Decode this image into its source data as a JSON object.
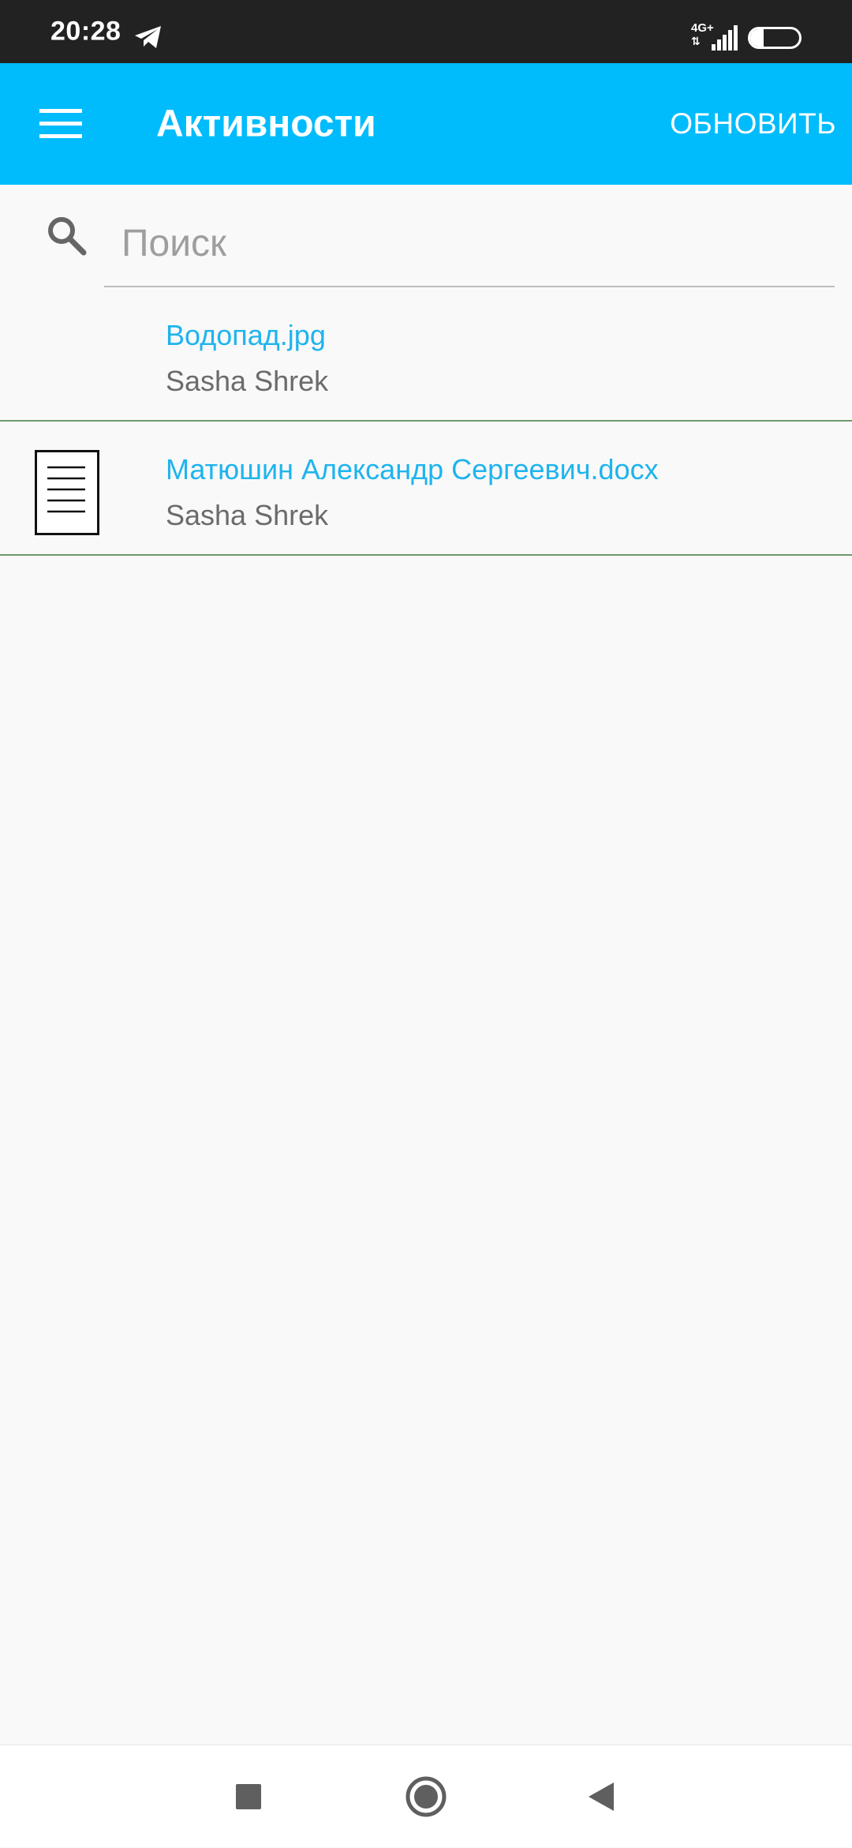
{
  "status_bar": {
    "time": "20:28",
    "network": "4G+",
    "network_arrows": "⇅",
    "battery": "28",
    "battery_level": 0.28
  },
  "app_bar": {
    "title": "Активности",
    "refresh_label": "ОБНОВИТЬ",
    "color": "#00bcfc"
  },
  "search": {
    "placeholder": "Поиск",
    "value": ""
  },
  "files": [
    {
      "name": "Водопад.jpg",
      "owner": "Sasha Shrek",
      "icon": "none"
    },
    {
      "name": "Матюшин Александр Сергеевич.docx",
      "owner": "Sasha Shrek",
      "icon": "document-icon"
    }
  ],
  "colors": {
    "accent": "#00bcfc",
    "file_name": "#1eb4ee",
    "owner_text": "#6b6b6b",
    "divider": "#6d9a6d"
  },
  "nav": {
    "recent": "recents-square-icon",
    "home": "home-circle-icon",
    "back": "back-triangle-icon"
  }
}
